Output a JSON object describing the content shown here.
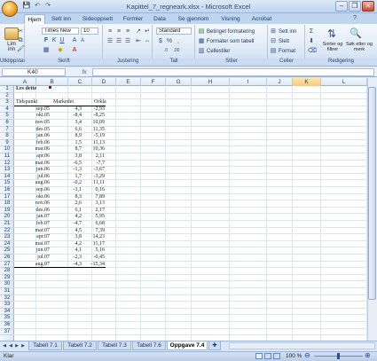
{
  "window": {
    "title": "Kapittel_7_regneark.xlsx - Microsoft Excel",
    "controls": [
      "–",
      "❐",
      "✕"
    ]
  },
  "ribbon_tabs": [
    "Hjem",
    "Sett inn",
    "Sideoppsett",
    "Formler",
    "Data",
    "Se gjennom",
    "Visning",
    "Acrobat"
  ],
  "ribbon": {
    "paste_label": "Lim\ninn",
    "font_name": "Times New Ro",
    "font_size": "10",
    "number_format": "Standard",
    "cond_format": "Betinget formatering",
    "format_table": "Formater som tabell",
    "cell_styles": "Cellestiler",
    "insert": "Sett inn",
    "delete": "Slett",
    "format": "Format",
    "sort_filter": "Sorter og filtrer",
    "find_select": "Søk etter og merk",
    "groups": [
      "Utklippstavle",
      "Skrift",
      "Justering",
      "Tall",
      "Stiler",
      "Celler",
      "Redigering"
    ]
  },
  "formula_bar": {
    "name_box": "K40",
    "fx": "fx",
    "formula": ""
  },
  "columns": [
    "A",
    "B",
    "C",
    "D",
    "E",
    "F",
    "G",
    "H",
    "I",
    "J",
    "K",
    "L"
  ],
  "selected_column": "K",
  "row_count": 37,
  "cells": {
    "a1": "Les dette",
    "headers": [
      "Tidspunkt",
      "Markedet",
      "Orkla"
    ],
    "rows": [
      [
        "sep.05",
        "4,3",
        "-2,93"
      ],
      [
        "okt.05",
        "-8,4",
        "-8,25"
      ],
      [
        "nov.05",
        "3,4",
        "10,09"
      ],
      [
        "des.05",
        "6,6",
        "11,35"
      ],
      [
        "jan.06",
        "8,9",
        "-5,19"
      ],
      [
        "feb.06",
        "1,5",
        "11,13"
      ],
      [
        "mar.06",
        "8,7",
        "10,36"
      ],
      [
        "apr.06",
        "3,8",
        "2,11"
      ],
      [
        "mai.06",
        "-6,5",
        "-7,7"
      ],
      [
        "jun.06",
        "-1,3",
        "-3,67"
      ],
      [
        "jul.06",
        "1,7",
        "-3,29"
      ],
      [
        "aug.06",
        "-0,2",
        "11,11"
      ],
      [
        "sep.06",
        "-3,1",
        "0,16"
      ],
      [
        "okt.06",
        "8,3",
        "7,89"
      ],
      [
        "nov.06",
        "2,6",
        "3,13"
      ],
      [
        "des.06",
        "6,1",
        "2,17"
      ],
      [
        "jan.07",
        "4,2",
        "5,95"
      ],
      [
        "feb.07",
        "-4,7",
        "6,68"
      ],
      [
        "mar.07",
        "4,5",
        "7,39"
      ],
      [
        "apr.07",
        "3,8",
        "14,23"
      ],
      [
        "mai.07",
        "4,2",
        "11,17"
      ],
      [
        "jun.07",
        "4,1",
        "5,16"
      ],
      [
        "jul.07",
        "-2,3",
        "-0,45"
      ],
      [
        "aug.07",
        "-4,3",
        "-15,34"
      ]
    ]
  },
  "sheet_tabs": [
    "Tabell 7.1",
    "Tabell 7.2",
    "Tabell 7.3",
    "Tabell 7.6",
    "Oppgave 7.4"
  ],
  "active_sheet": "Oppgave 7.4",
  "status": {
    "text": "Klar",
    "zoom": "100 %"
  }
}
